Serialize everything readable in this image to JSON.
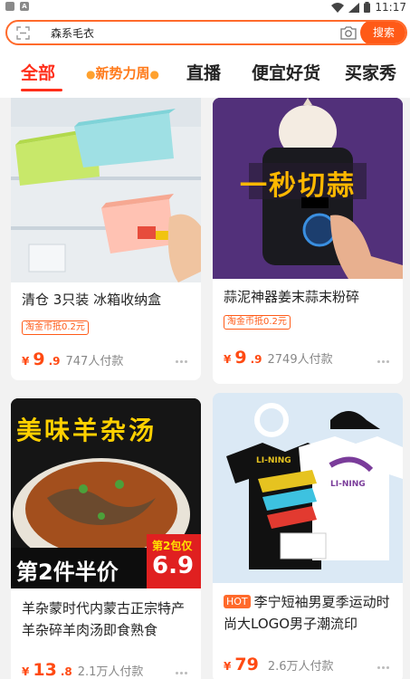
{
  "status_bar": {
    "time": "11:17"
  },
  "search": {
    "query": "森系毛衣",
    "button_label": "搜索"
  },
  "tabs": {
    "all": "全部",
    "new_weekly": "新势力周",
    "live": "直播",
    "cheap_good": "便宜好货",
    "buyer_show": "买家秀"
  },
  "products": [
    {
      "title": "清仓 3只装 冰箱收纳盒",
      "coupon": "淘金币抵0.2元",
      "price_currency": "¥",
      "price_int": "9",
      "price_dec": ".9",
      "sold": "747人付款"
    },
    {
      "title": "蒜泥神器姜末蒜末粉碎",
      "coupon": "淘金币抵0.2元",
      "image_caption": "一秒切蒜",
      "price_currency": "¥",
      "price_int": "9",
      "price_dec": ".9",
      "sold": "2749人付款"
    },
    {
      "title": "羊杂蒙时代内蒙古正宗特产羊杂碎羊肉汤即食熟食",
      "image_caption": "美味羊杂汤",
      "promo_label": "第2件半价",
      "promo_tag": "第2包仅",
      "promo_price": "6.9",
      "price_currency": "¥",
      "price_int": "13",
      "price_dec": ".8",
      "sold": "2.1万人付款"
    },
    {
      "badge": "HOT",
      "title": "李宁短袖男夏季运动时尚大LOGO男子潮流印",
      "brand_text": "LI-NING",
      "price_currency": "¥",
      "price_int": "79",
      "price_dec": "",
      "sold": "2.6万人付款"
    }
  ],
  "colors": {
    "accent": "#ff5a17",
    "tab_active": "#ff2e1a",
    "price": "#ff4a12"
  }
}
